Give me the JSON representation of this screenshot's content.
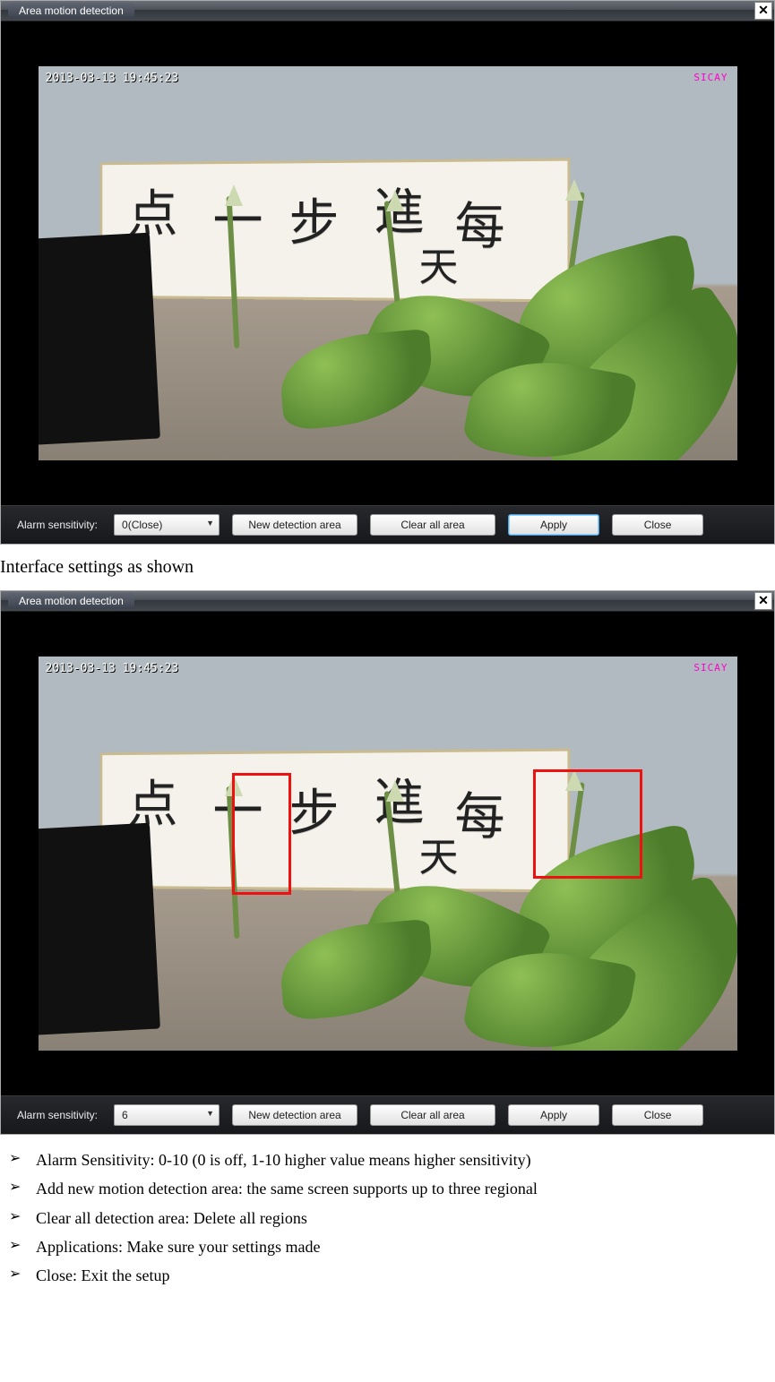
{
  "window1": {
    "title": "Area motion detection",
    "close_glyph": "✕",
    "timestamp": "2013-03-13 19:45:23",
    "brand": "SICAY",
    "calligraphy": [
      "每",
      "一",
      "步",
      "進",
      "点",
      "天"
    ],
    "toolbar": {
      "sens_label": "Alarm sensitivity:",
      "sens_value": "0(Close)",
      "new_area": "New detection area",
      "clear": "Clear all area",
      "apply": "Apply",
      "close": "Close"
    }
  },
  "caption": "Interface settings as shown",
  "window2": {
    "title": "Area motion detection",
    "close_glyph": "✕",
    "timestamp": "2013-03-13 19:45:23",
    "brand": "SICAY",
    "calligraphy": [
      "每",
      "一",
      "步",
      "進",
      "点",
      "天"
    ],
    "toolbar": {
      "sens_label": "Alarm sensitivity:",
      "sens_value": "6",
      "new_area": "New detection area",
      "clear": "Clear all area",
      "apply": "Apply",
      "close": "Close"
    }
  },
  "notes": [
    "Alarm Sensitivity: 0-10 (0 is off, 1-10 higher value means higher sensitivity)",
    "Add new motion detection area: the same screen supports up to three regional",
    "Clear all detection area: Delete all regions",
    "Applications: Make sure your settings made",
    "Close: Exit the setup"
  ]
}
